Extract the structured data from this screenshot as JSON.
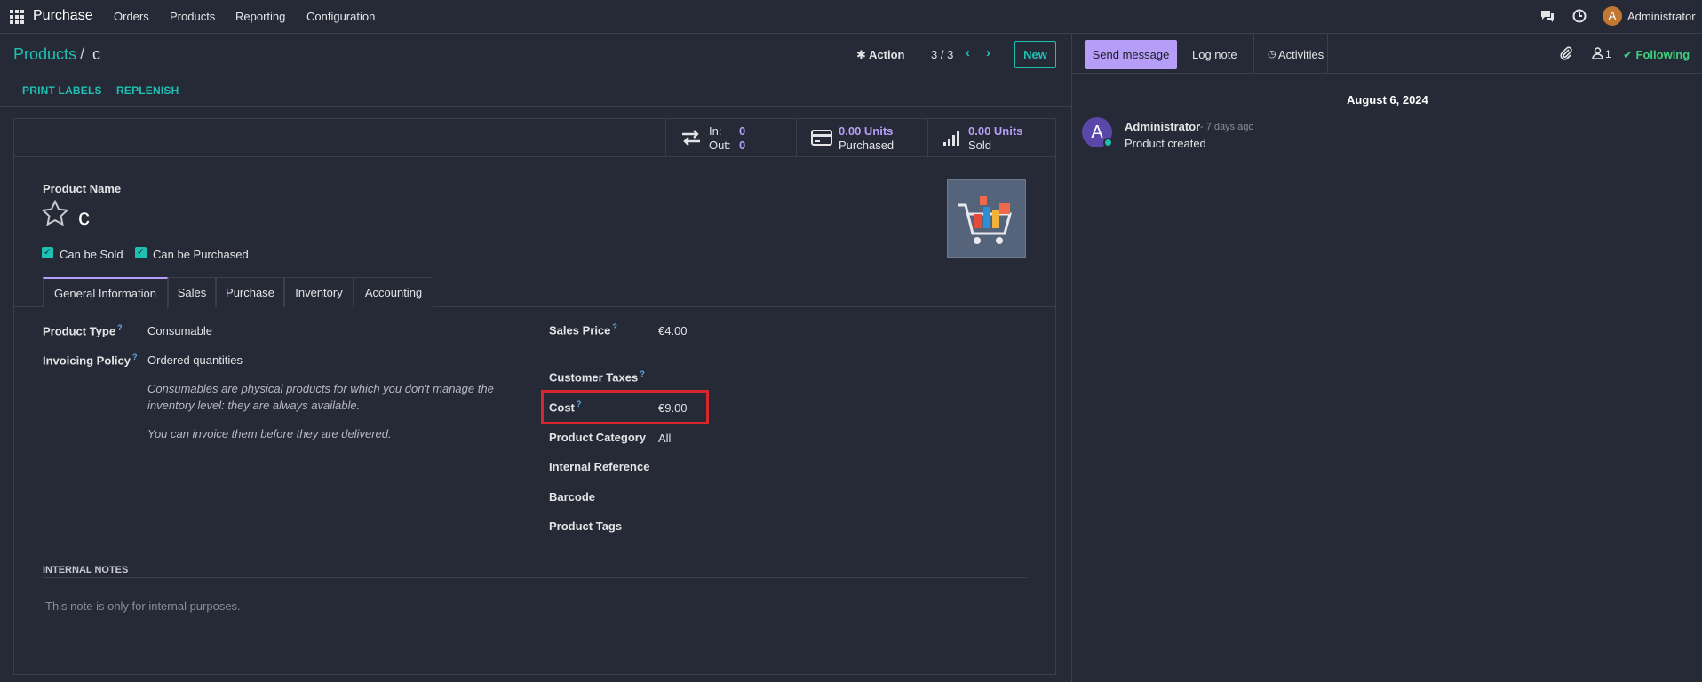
{
  "nav": {
    "app_name": "Purchase",
    "menu": [
      "Orders",
      "Products",
      "Reporting",
      "Configuration"
    ],
    "user_initial": "A",
    "user_name": "Administrator"
  },
  "control": {
    "breadcrumb_parent": "Products",
    "breadcrumb_sep": "/",
    "breadcrumb_current": "c",
    "action_label": "Action",
    "pager": "3 / 3",
    "new_label": "New"
  },
  "statusbar": {
    "buttons": [
      "PRINT LABELS",
      "REPLENISH"
    ]
  },
  "smart_buttons": {
    "in_label": "In:",
    "in_value": "0",
    "out_label": "Out:",
    "out_value": "0",
    "purchased_value": "0.00 Units",
    "purchased_label": "Purchased",
    "sold_value": "0.00 Units",
    "sold_label": "Sold"
  },
  "product": {
    "name_label": "Product Name",
    "name": "c",
    "can_be_sold": "Can be Sold",
    "can_be_purchased": "Can be Purchased"
  },
  "tabs": [
    "General Information",
    "Sales",
    "Purchase",
    "Inventory",
    "Accounting"
  ],
  "general": {
    "product_type_label": "Product Type",
    "product_type": "Consumable",
    "invoicing_policy_label": "Invoicing Policy",
    "invoicing_policy": "Ordered quantities",
    "note1_line1": "Consumables are physical products for which you don't manage the",
    "note1_line2": "inventory level: they are always available.",
    "note2": "You can invoice them before they are delivered.",
    "sales_price_label": "Sales Price",
    "sales_price": "€4.00",
    "customer_taxes_label": "Customer Taxes",
    "cost_label": "Cost",
    "cost": "€9.00",
    "category_label": "Product Category",
    "category": "All",
    "internal_ref_label": "Internal Reference",
    "barcode_label": "Barcode",
    "tags_label": "Product Tags",
    "help_mark": "?"
  },
  "notes": {
    "title": "INTERNAL NOTES",
    "placeholder": "This note is only for internal purposes."
  },
  "chatter": {
    "send_message": "Send message",
    "log_note": "Log note",
    "activities": "Activities",
    "followers_count": "1",
    "following": "Following",
    "date": "August 6, 2024",
    "author_initial": "A",
    "author": "Administrator",
    "time": "- 7 days ago",
    "message": "Product created"
  },
  "colors": {
    "accent_teal": "#1ec0b4",
    "accent_purple": "#b69df8",
    "highlight_red": "#d9262b",
    "following_green": "#3dd07a"
  }
}
